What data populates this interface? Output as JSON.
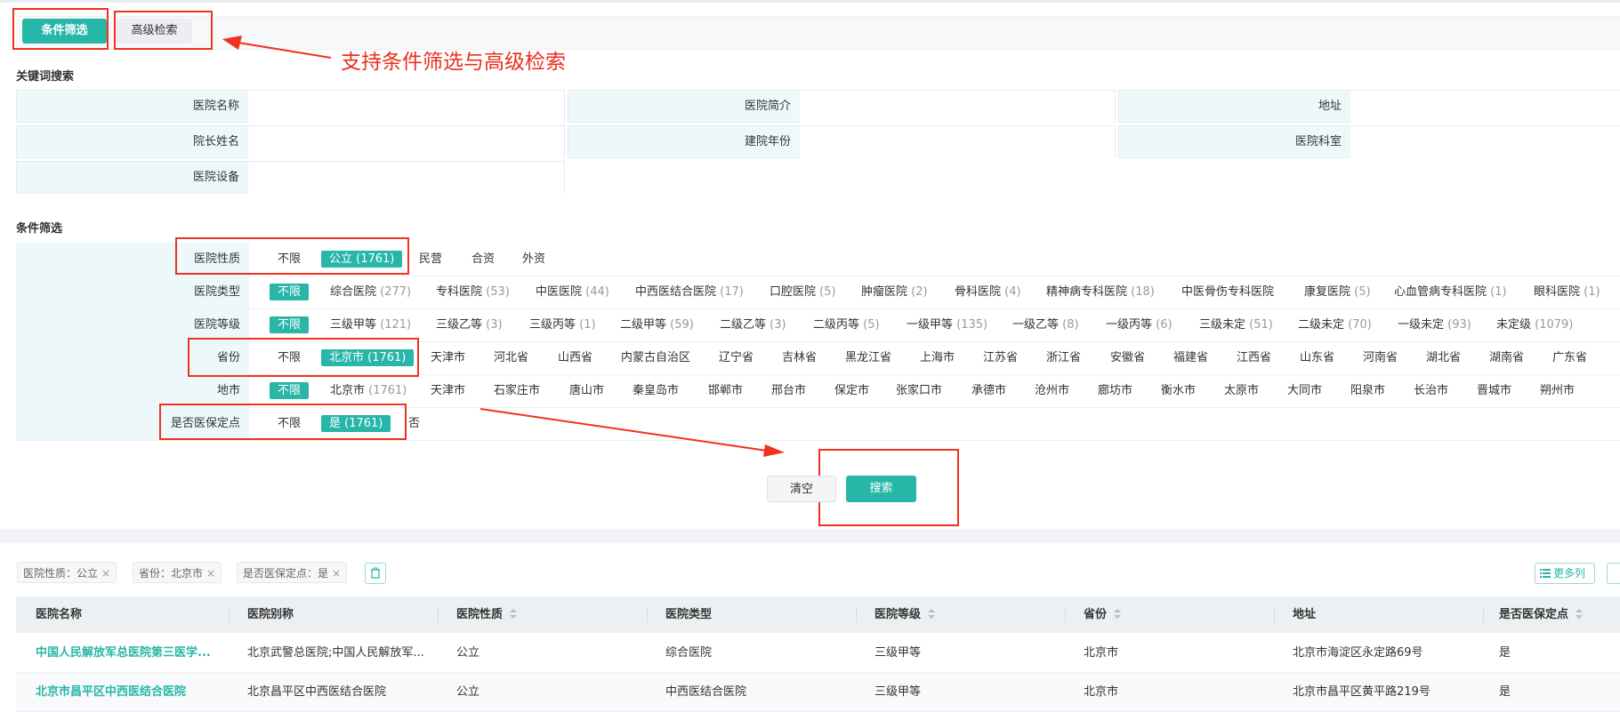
{
  "tabs": {
    "condition": "条件筛选",
    "advanced": "高级检索"
  },
  "callout": "支持条件筛选与高级检索",
  "keyword_section": {
    "title": "关键词搜索",
    "fields": [
      {
        "label": "医院名称",
        "value": ""
      },
      {
        "label": "医院简介",
        "value": ""
      },
      {
        "label": "地址",
        "value": ""
      },
      {
        "label": "院长姓名",
        "value": ""
      },
      {
        "label": "建院年份",
        "value": ""
      },
      {
        "label": "医院科室",
        "value": ""
      },
      {
        "label": "医院设备",
        "value": ""
      }
    ]
  },
  "filter_section": {
    "title": "条件筛选",
    "rows": [
      {
        "label": "医院性质",
        "options": [
          {
            "text": "不限",
            "count": ""
          },
          {
            "text": "公立 (1761)",
            "count": "",
            "selected": true
          },
          {
            "text": "民营",
            "count": ""
          },
          {
            "text": "合资",
            "count": ""
          },
          {
            "text": "外资",
            "count": ""
          }
        ]
      },
      {
        "label": "医院类型",
        "options": [
          {
            "text": "不限",
            "count": "",
            "selected": true
          },
          {
            "text": "综合医院",
            "count": "(277)"
          },
          {
            "text": "专科医院",
            "count": "(53)"
          },
          {
            "text": "中医医院",
            "count": "(44)"
          },
          {
            "text": "中西医结合医院",
            "count": "(17)"
          },
          {
            "text": "口腔医院",
            "count": "(5)"
          },
          {
            "text": "肿瘤医院",
            "count": "(2)"
          },
          {
            "text": "骨科医院",
            "count": "(4)"
          },
          {
            "text": "精神病专科医院",
            "count": "(18)"
          },
          {
            "text": "中医骨伤专科医院",
            "count": ""
          },
          {
            "text": "康复医院",
            "count": "(5)"
          },
          {
            "text": "心血管病专科医院",
            "count": "(1)"
          },
          {
            "text": "眼科医院",
            "count": "(1)"
          }
        ]
      },
      {
        "label": "医院等级",
        "options": [
          {
            "text": "不限",
            "count": "",
            "selected": true
          },
          {
            "text": "三级甲等",
            "count": "(121)"
          },
          {
            "text": "三级乙等",
            "count": "(3)"
          },
          {
            "text": "三级丙等",
            "count": "(1)"
          },
          {
            "text": "二级甲等",
            "count": "(59)"
          },
          {
            "text": "二级乙等",
            "count": "(3)"
          },
          {
            "text": "二级丙等",
            "count": "(5)"
          },
          {
            "text": "一级甲等",
            "count": "(135)"
          },
          {
            "text": "一级乙等",
            "count": "(8)"
          },
          {
            "text": "一级丙等",
            "count": "(6)"
          },
          {
            "text": "三级未定",
            "count": "(51)"
          },
          {
            "text": "二级未定",
            "count": "(70)"
          },
          {
            "text": "一级未定",
            "count": "(93)"
          },
          {
            "text": "未定级",
            "count": "(1079)"
          }
        ]
      },
      {
        "label": "省份",
        "options": [
          {
            "text": "不限",
            "count": ""
          },
          {
            "text": "北京市 (1761)",
            "count": "",
            "selected": true
          },
          {
            "text": "天津市",
            "count": ""
          },
          {
            "text": "河北省",
            "count": ""
          },
          {
            "text": "山西省",
            "count": ""
          },
          {
            "text": "内蒙古自治区",
            "count": ""
          },
          {
            "text": "辽宁省",
            "count": ""
          },
          {
            "text": "吉林省",
            "count": ""
          },
          {
            "text": "黑龙江省",
            "count": ""
          },
          {
            "text": "上海市",
            "count": ""
          },
          {
            "text": "江苏省",
            "count": ""
          },
          {
            "text": "浙江省",
            "count": ""
          },
          {
            "text": "安徽省",
            "count": ""
          },
          {
            "text": "福建省",
            "count": ""
          },
          {
            "text": "江西省",
            "count": ""
          },
          {
            "text": "山东省",
            "count": ""
          },
          {
            "text": "河南省",
            "count": ""
          },
          {
            "text": "湖北省",
            "count": ""
          },
          {
            "text": "湖南省",
            "count": ""
          },
          {
            "text": "广东省",
            "count": ""
          }
        ]
      },
      {
        "label": "地市",
        "options": [
          {
            "text": "不限",
            "count": "",
            "selected": true
          },
          {
            "text": "北京市",
            "count": "(1761)"
          },
          {
            "text": "天津市",
            "count": ""
          },
          {
            "text": "石家庄市",
            "count": ""
          },
          {
            "text": "唐山市",
            "count": ""
          },
          {
            "text": "秦皇岛市",
            "count": ""
          },
          {
            "text": "邯郸市",
            "count": ""
          },
          {
            "text": "邢台市",
            "count": ""
          },
          {
            "text": "保定市",
            "count": ""
          },
          {
            "text": "张家口市",
            "count": ""
          },
          {
            "text": "承德市",
            "count": ""
          },
          {
            "text": "沧州市",
            "count": ""
          },
          {
            "text": "廊坊市",
            "count": ""
          },
          {
            "text": "衡水市",
            "count": ""
          },
          {
            "text": "太原市",
            "count": ""
          },
          {
            "text": "大同市",
            "count": ""
          },
          {
            "text": "阳泉市",
            "count": ""
          },
          {
            "text": "长治市",
            "count": ""
          },
          {
            "text": "晋城市",
            "count": ""
          },
          {
            "text": "朔州市",
            "count": ""
          }
        ]
      },
      {
        "label": "是否医保定点",
        "options": [
          {
            "text": "不限",
            "count": ""
          },
          {
            "text": "是 (1761)",
            "count": "",
            "selected": true
          },
          {
            "text": "否",
            "count": ""
          }
        ]
      }
    ]
  },
  "buttons": {
    "clear": "清空",
    "search": "搜索"
  },
  "active_filters": [
    {
      "text": "医院性质：公立"
    },
    {
      "text": "省份：北京市"
    },
    {
      "text": "是否医保定点：是"
    }
  ],
  "more_columns": "更多列",
  "table": {
    "columns": [
      {
        "label": "医院名称",
        "sortable": false
      },
      {
        "label": "医院别称",
        "sortable": false
      },
      {
        "label": "医院性质",
        "sortable": true
      },
      {
        "label": "医院类型",
        "sortable": false
      },
      {
        "label": "医院等级",
        "sortable": true
      },
      {
        "label": "省份",
        "sortable": true
      },
      {
        "label": "地址",
        "sortable": false
      },
      {
        "label": "是否医保定点",
        "sortable": true
      }
    ],
    "rows": [
      [
        "中国人民解放军总医院第三医学...",
        "北京武警总医院;中国人民解放军...",
        "公立",
        "综合医院",
        "三级甲等",
        "北京市",
        "北京市海淀区永定路69号",
        "是"
      ],
      [
        "北京市昌平区中西医结合医院",
        "北京昌平区中西医结合医院",
        "公立",
        "中西医结合医院",
        "三级甲等",
        "北京市",
        "北京市昌平区黄平路219号",
        "是"
      ]
    ]
  },
  "colors": {
    "accent": "#27b6a8",
    "annotation": "#f0321e"
  }
}
